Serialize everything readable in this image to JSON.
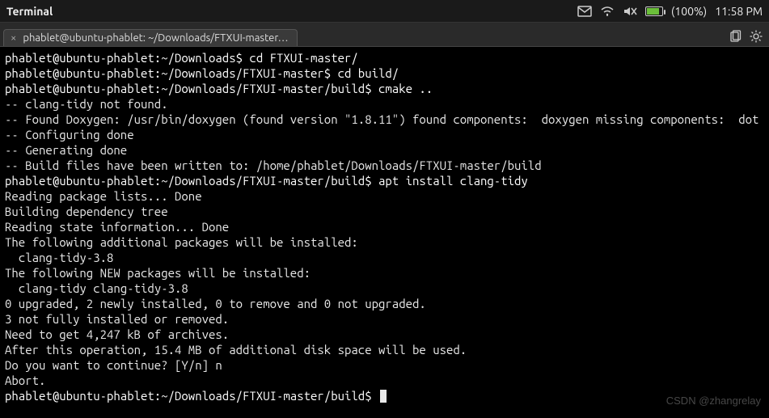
{
  "menubar": {
    "title": "Terminal",
    "battery_pct": "(100%)",
    "time": "11:58 PM"
  },
  "tab": {
    "title": "phablet@ubuntu-phablet: ~/Downloads/FTXUI-master…"
  },
  "terminal": {
    "lines": [
      {
        "prompt": "phablet@ubuntu-phablet:~/Downloads$",
        "cmd": " cd FTXUI-master/"
      },
      {
        "prompt": "phablet@ubuntu-phablet:~/Downloads/FTXUI-master$",
        "cmd": " cd build/"
      },
      {
        "prompt": "phablet@ubuntu-phablet:~/Downloads/FTXUI-master/build$",
        "cmd": " cmake .."
      },
      {
        "text": "-- clang-tidy not found."
      },
      {
        "text": "-- Found Doxygen: /usr/bin/doxygen (found version \"1.8.11\") found components:  doxygen missing components:  dot"
      },
      {
        "text": "-- Configuring done"
      },
      {
        "text": "-- Generating done"
      },
      {
        "text": "-- Build files have been written to: /home/phablet/Downloads/FTXUI-master/build"
      },
      {
        "prompt": "phablet@ubuntu-phablet:~/Downloads/FTXUI-master/build$",
        "cmd": " apt install clang-tidy"
      },
      {
        "text": "Reading package lists... Done"
      },
      {
        "text": "Building dependency tree"
      },
      {
        "text": "Reading state information... Done"
      },
      {
        "text": "The following additional packages will be installed:"
      },
      {
        "text": "  clang-tidy-3.8"
      },
      {
        "text": "The following NEW packages will be installed:"
      },
      {
        "text": "  clang-tidy clang-tidy-3.8"
      },
      {
        "text": "0 upgraded, 2 newly installed, 0 to remove and 0 not upgraded."
      },
      {
        "text": "3 not fully installed or removed."
      },
      {
        "text": "Need to get 4,247 kB of archives."
      },
      {
        "text": "After this operation, 15.4 MB of additional disk space will be used."
      },
      {
        "text": "Do you want to continue? [Y/n] n"
      },
      {
        "text": "Abort."
      },
      {
        "prompt": "phablet@ubuntu-phablet:~/Downloads/FTXUI-master/build$",
        "cmd": " ",
        "cursor": true
      }
    ]
  },
  "watermark": "CSDN @zhangrelay"
}
